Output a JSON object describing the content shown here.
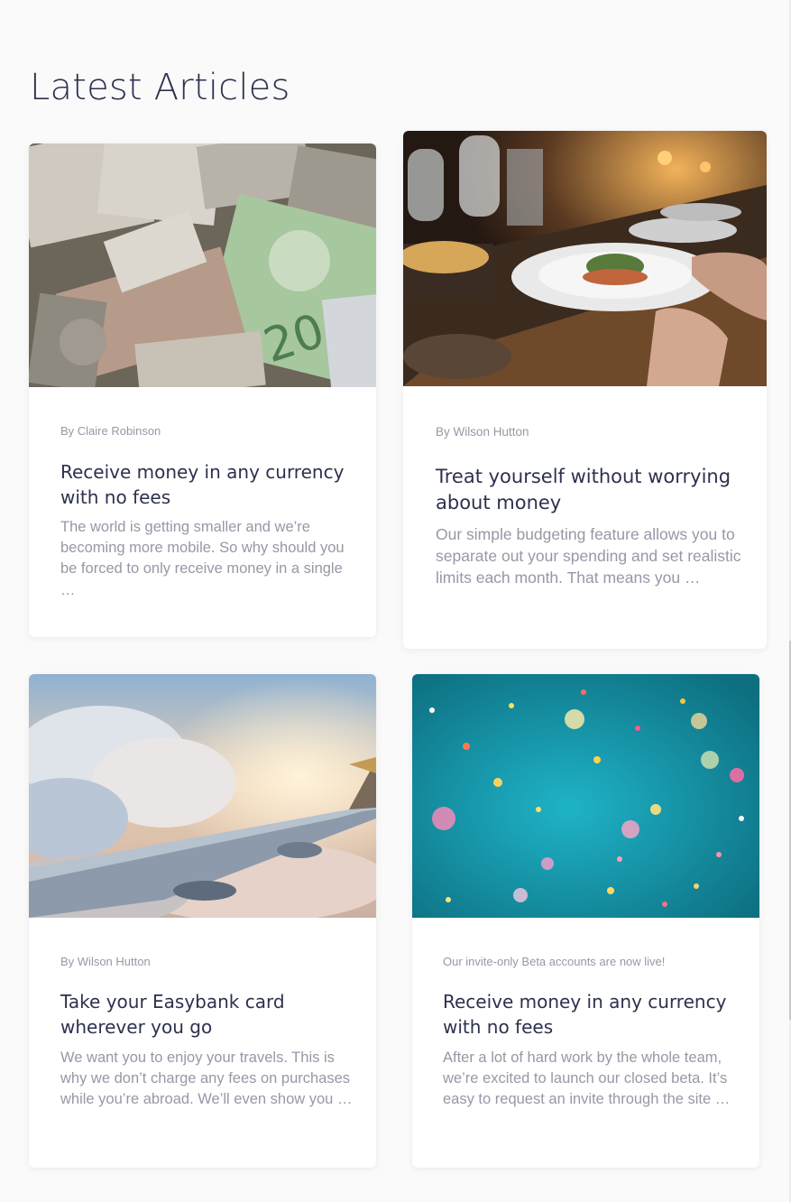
{
  "section": {
    "title": "Latest Articles"
  },
  "articles": [
    {
      "image_icon": "money-banknotes-image",
      "author": "By Claire Robinson",
      "title": "Receive money in any currency with no fees",
      "excerpt": "The world is getting smaller and we’re becoming more mobile. So why should you be forced to only receive money in a single …"
    },
    {
      "image_icon": "restaurant-dinner-image",
      "author": "By Wilson Hutton",
      "title": "Treat yourself without worrying about money",
      "excerpt": "Our simple budgeting feature allows you to separate out your spending and set realistic limits each month. That means you …"
    },
    {
      "image_icon": "airplane-wing-image",
      "author": "By Wilson Hutton",
      "title": "Take your Easybank card wherever you go",
      "excerpt": "We want you to enjoy your travels. This is why we don’t charge any fees on purchases while you’re abroad. We’ll even show you …"
    },
    {
      "image_icon": "confetti-image",
      "author": "Our invite-only Beta accounts are now live!",
      "title": "Receive money in any currency with no fees",
      "excerpt": "After a lot of hard work by the whole team, we’re excited to launch our closed beta. It’s easy to request an invite through the site …"
    }
  ],
  "colors": {
    "heading": "#2d314d",
    "muted_text": "#9698a6",
    "page_bg": "#fafafa",
    "card_bg": "#ffffff"
  }
}
